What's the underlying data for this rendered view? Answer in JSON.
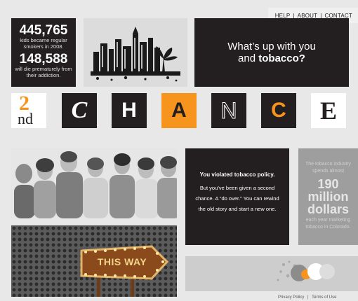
{
  "nav": {
    "help": "HELP",
    "about": "ABOUT",
    "contact": "CONTACT",
    "separator": "|"
  },
  "stats": {
    "num1": "445,765",
    "cap1": "kids became regular smokers in 2008.",
    "num2": "148,588",
    "cap2": "will die prematurely from their addiction."
  },
  "headline": {
    "line1": "What’s up with you",
    "line2_pre": "and ",
    "line2_bold": "tobacco?"
  },
  "chance": {
    "prefix_num": "2",
    "prefix_suffix": "nd",
    "letters": [
      "C",
      "H",
      "A",
      "N",
      "C",
      "E"
    ]
  },
  "violation": {
    "heading": "You violated tobacco policy.",
    "body": "But you’ve been given a second chance.  A “do over.” You can rewind the old story and start a new one."
  },
  "industry": {
    "pre": "The tobacco industry spends almost",
    "big1": "190",
    "big2": "million",
    "big3": "dollars",
    "post": "each year marketing tobacco in Colorado."
  },
  "thisway": {
    "sign_text": "THIS WAY"
  },
  "footer": {
    "privacy": "Privacy Policy",
    "separator": "|",
    "terms": "Terms of Use"
  },
  "colors": {
    "orange": "#f7941d",
    "dark": "#231f20",
    "grey": "#9e9e9e"
  }
}
